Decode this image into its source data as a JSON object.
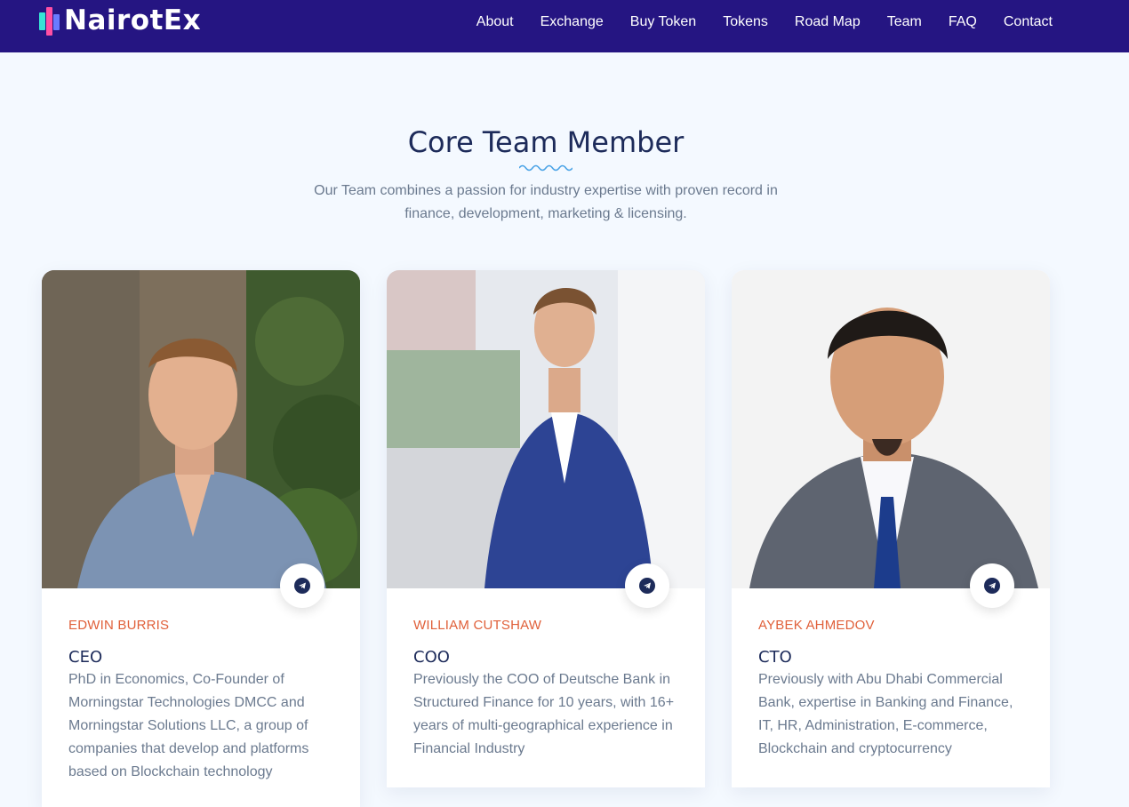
{
  "brand": {
    "name": "NairotEx"
  },
  "nav": {
    "items": [
      "About",
      "Exchange",
      "Buy Token",
      "Tokens",
      "Road Map",
      "Team",
      "FAQ",
      "Contact"
    ]
  },
  "team_section": {
    "title": "Core Team Member",
    "subtitle": "Our Team combines a passion for industry expertise with proven record in finance, development, marketing & licensing.",
    "members": [
      {
        "name": "EDWIN BURRIS",
        "role": "CEO",
        "bio": "PhD in Economics, Co-Founder of Morningstar Technologies DMCC and Morningstar Solutions LLC, a group of companies that develop and platforms based on Blockchain technology",
        "social_icon": "telegram-icon"
      },
      {
        "name": "WILLIAM CUTSHAW",
        "role": "COO",
        "bio": "Previously the COO of Deutsche Bank in Structured Finance for 10 years, with 16+ years of multi-geographical experience in Financial Industry",
        "social_icon": "telegram-icon"
      },
      {
        "name": "AYBEK AHMEDOV",
        "role": "CTO",
        "bio": "Previously with Abu Dhabi Commercial Bank, expertise in Banking and Finance, IT, HR, Administration, E-commerce, Blockchain and cryptocurrency",
        "social_icon": "telegram-icon"
      }
    ]
  },
  "colors": {
    "nav_bg": "#251582",
    "page_bg": "#f4f9ff",
    "heading": "#1d2b5a",
    "name_accent": "#e0603a",
    "body_text": "#6b7a8f",
    "squiggle": "#4aa3e6"
  }
}
